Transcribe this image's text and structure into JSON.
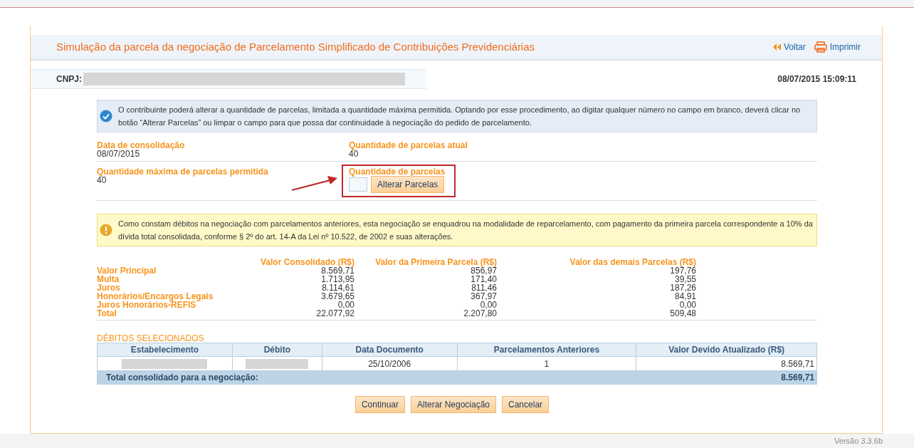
{
  "header": {
    "title": "Simulação da parcela da negociação de Parcelamento Simplificado de Contribuições Previdenciárias",
    "back_link": "Voltar",
    "print_link": "Imprimir"
  },
  "cnpj_label": "CNPJ:",
  "timestamp": "08/07/2015 15:09:11",
  "info_message": "O contribuinte poderá alterar a quantidade de parcelas, limitada a quantidade máxima permitida. Optando por esse procedimento, ao digitar qualquer número no campo em branco, deverá clicar no botão “Alterar Parcelas” ou limpar o campo para que possa dar continuidade à negociação do pedido de parcelamento.",
  "fields": [
    {
      "label": "Data de consolidação",
      "value": "08/07/2015"
    },
    {
      "label": "Quantidade de parcelas atual",
      "value": "40"
    },
    {
      "label": "Quantidade máxima de parcelas permitida",
      "value": "40"
    }
  ],
  "installments_input": {
    "label": "Quantidade de parcelas",
    "button": "Alterar Parcelas"
  },
  "warning_message": "Como constam débitos na negociação com parcelamentos anteriores, esta negociação se enquadrou na modalidade de reparcelamento, com pagamento da primeira parcela correspondente a 10% da dívida total consolidada, conforme § 2º do art. 14-A da Lei nº 10.522, de 2002 e suas alterações.",
  "values_table": {
    "columns": [
      "Valor Consolidado (R$)",
      "Valor da Primeira Parcela (R$)",
      "Valor das demais Parcelas (R$)"
    ],
    "rows": [
      {
        "label": "Valor Principal",
        "values": [
          "8.569,71",
          "856,97",
          "197,76"
        ]
      },
      {
        "label": "Multa",
        "values": [
          "1.713,95",
          "171,40",
          "39,55"
        ]
      },
      {
        "label": "Juros",
        "values": [
          "8.114,61",
          "811,46",
          "187,26"
        ]
      },
      {
        "label": "Honorários/Encargos Legais",
        "values": [
          "3.679,65",
          "367,97",
          "84,91"
        ]
      },
      {
        "label": "Juros Honorários-REFIS",
        "values": [
          "0,00",
          "0,00",
          "0,00"
        ]
      },
      {
        "label": "Total",
        "values": [
          "22.077,92",
          "2.207,80",
          "509,48"
        ]
      }
    ]
  },
  "debts": {
    "title": "DÉBITOS SELECIONADOS",
    "columns": [
      "Estabelecimento",
      "Débito",
      "Data Documento",
      "Parcelamentos Anteriores",
      "Valor Devido Atualizado (R$)"
    ],
    "rows": [
      {
        "data_documento": "25/10/2006",
        "parcelamentos": "1",
        "valor": "8.569,71"
      }
    ],
    "total_label": "Total consolidado para a negociação:",
    "total_value": "8.569,71"
  },
  "buttons": [
    "Continuar",
    "Alterar Negociação",
    "Cancelar"
  ],
  "version": "Versão 3.3.6b"
}
